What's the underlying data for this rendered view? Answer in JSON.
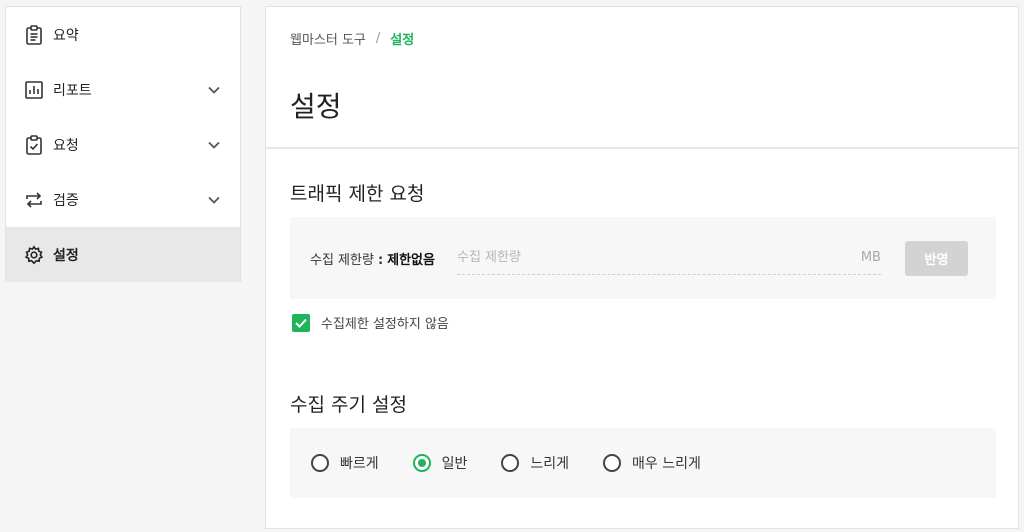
{
  "sidebar": {
    "items": [
      {
        "label": "요약",
        "icon": "clipboard-icon",
        "expandable": false,
        "active": false
      },
      {
        "label": "리포트",
        "icon": "bar-chart-icon",
        "expandable": true,
        "active": false
      },
      {
        "label": "요청",
        "icon": "clipboard-check-icon",
        "expandable": true,
        "active": false
      },
      {
        "label": "검증",
        "icon": "swap-arrows-icon",
        "expandable": true,
        "active": false
      },
      {
        "label": "설정",
        "icon": "gear-icon",
        "expandable": false,
        "active": true
      }
    ]
  },
  "breadcrumb": {
    "parent": "웹마스터 도구",
    "separator": "/",
    "current": "설정"
  },
  "page": {
    "title": "설정"
  },
  "traffic": {
    "title": "트래픽 제한 요청",
    "limit_label": "수집 제한량",
    "limit_colon": ":",
    "limit_value": "제한없음",
    "input_placeholder": "수집 제한량",
    "input_value": "",
    "unit": "MB",
    "apply_label": "반영",
    "checkbox_label": "수집제한 설정하지 않음",
    "checkbox_checked": true
  },
  "cycle": {
    "title": "수집 주기 설정",
    "options": [
      {
        "label": "빠르게",
        "checked": false
      },
      {
        "label": "일반",
        "checked": true
      },
      {
        "label": "느리게",
        "checked": false
      },
      {
        "label": "매우 느리게",
        "checked": false
      }
    ]
  },
  "colors": {
    "accent": "#1db45a",
    "disabled_button": "#d3d3d3",
    "active_nav_bg": "#e8e8e8"
  }
}
